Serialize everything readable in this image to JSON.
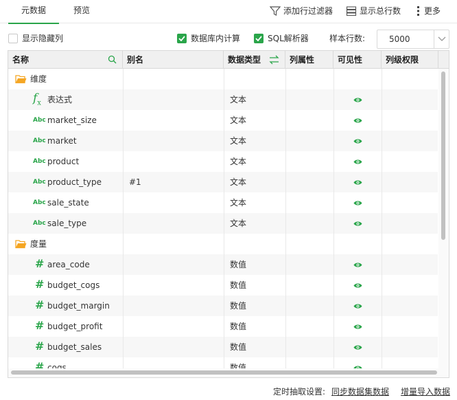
{
  "tabs": [
    {
      "label": "元数据"
    },
    {
      "label": "预览"
    }
  ],
  "toolbar": {
    "add_filter": "添加行过滤器",
    "show_total": "显示总行数",
    "more": "更多"
  },
  "options": {
    "show_hidden": "显示隐藏列",
    "db_compute": "数据库内计算",
    "sql_parser": "SQL解析器",
    "sample_rows_label": "样本行数:",
    "sample_rows_value": "5000"
  },
  "columns": [
    "名称",
    "别名",
    "数据类型",
    "列属性",
    "可见性",
    "列级权限"
  ],
  "groups": {
    "dimension": "维度",
    "measure": "度量"
  },
  "rows": [
    {
      "type": "folder",
      "name": "维度",
      "alias": "",
      "dtype": "",
      "visible": false
    },
    {
      "type": "fx",
      "name": "表达式",
      "alias": "",
      "dtype": "文本",
      "visible": true
    },
    {
      "type": "abc",
      "name": "market_size",
      "alias": "",
      "dtype": "文本",
      "visible": true
    },
    {
      "type": "abc",
      "name": "market",
      "alias": "",
      "dtype": "文本",
      "visible": true
    },
    {
      "type": "abc",
      "name": "product",
      "alias": "",
      "dtype": "文本",
      "visible": true
    },
    {
      "type": "abc",
      "name": "product_type",
      "alias": "#1",
      "dtype": "文本",
      "visible": true
    },
    {
      "type": "abc",
      "name": "sale_state",
      "alias": "",
      "dtype": "文本",
      "visible": true
    },
    {
      "type": "abc",
      "name": "sale_type",
      "alias": "",
      "dtype": "文本",
      "visible": true
    },
    {
      "type": "folder",
      "name": "度量",
      "alias": "",
      "dtype": "",
      "visible": false
    },
    {
      "type": "num",
      "name": "area_code",
      "alias": "",
      "dtype": "数值",
      "visible": true
    },
    {
      "type": "num",
      "name": "budget_cogs",
      "alias": "",
      "dtype": "数值",
      "visible": true
    },
    {
      "type": "num",
      "name": "budget_margin",
      "alias": "",
      "dtype": "数值",
      "visible": true
    },
    {
      "type": "num",
      "name": "budget_profit",
      "alias": "",
      "dtype": "数值",
      "visible": true
    },
    {
      "type": "num",
      "name": "budget_sales",
      "alias": "",
      "dtype": "数值",
      "visible": true
    },
    {
      "type": "num",
      "name": "cogs",
      "alias": "",
      "dtype": "数值",
      "visible": true
    }
  ],
  "icon_labels": {
    "abc": "Abc",
    "num": "#",
    "fx": "f"
  },
  "footer": {
    "label": "定时抽取设置:",
    "sync": "同步数据集数据",
    "import": "增量导入数据"
  },
  "colors": {
    "accent": "#2aa54a",
    "folder": "#f5a623"
  }
}
